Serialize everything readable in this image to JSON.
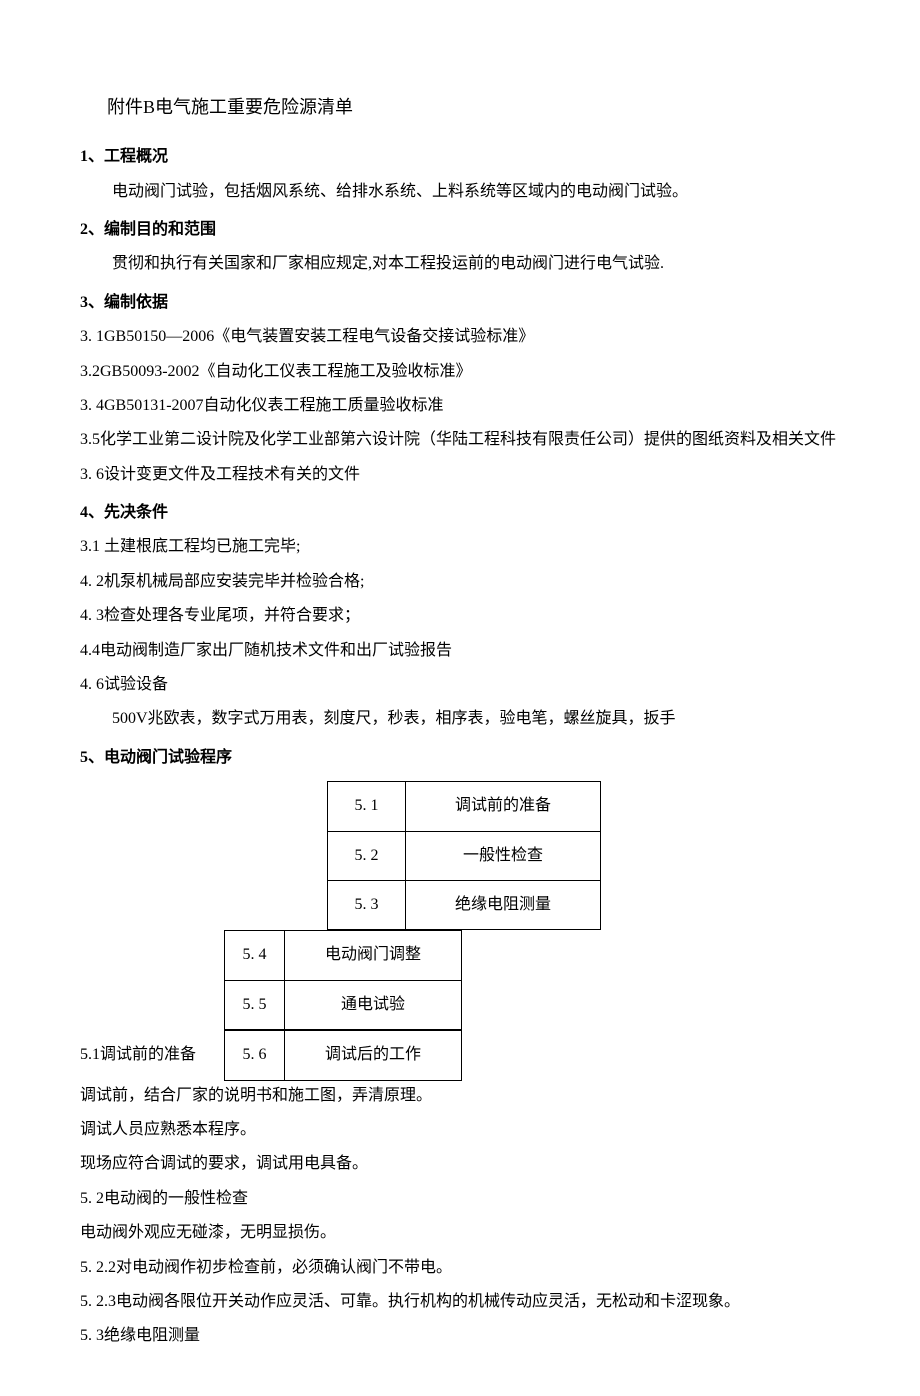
{
  "title": "附件B电气施工重要危险源清单",
  "s1": {
    "heading": "1、工程概况",
    "p1": "电动阀门试验，包括烟风系统、给排水系统、上料系统等区域内的电动阀门试验。"
  },
  "s2": {
    "heading": "2、编制目的和范围",
    "p1": "贯彻和执行有关国家和厂家相应规定,对本工程投运前的电动阀门进行电气试验."
  },
  "s3": {
    "heading": "3、编制依据",
    "i1": "3.  1GB50150—2006《电气装置安装工程电气设备交接试验标准》",
    "i2": "3.2GB50093-2002《自动化工仪表工程施工及验收标准》",
    "i3": "3.  4GB50131-2007自动化仪表工程施工质量验收标准",
    "i4": "3.5化学工业第二设计院及化学工业部第六设计院（华陆工程科技有限责任公司）提供的图纸资料及相关文件",
    "i5": "3.  6设计变更文件及工程技术有关的文件"
  },
  "s4": {
    "heading": "4、先决条件",
    "i1": "3.1  土建根底工程均已施工完毕;",
    "i2": "4.  2机泵机械局部应安装完毕并检验合格;",
    "i3": "4.  3检查处理各专业尾项，并符合要求；",
    "i4": "4.4电动阀制造厂家出厂随机技术文件和出厂试验报告",
    "i5": "4.  6试验设备",
    "i5b": "500V兆欧表，数字式万用表，刻度尺，秒表，相序表，验电笔，螺丝旋具，扳手"
  },
  "s5": {
    "heading": "5、电动阀门试验程序",
    "rows1": [
      {
        "num": "5. 1",
        "text": "调试前的准备"
      },
      {
        "num": "5. 2",
        "text": "一般性检查"
      },
      {
        "num": "5. 3",
        "text": "绝缘电阻测量"
      }
    ],
    "rows2": [
      {
        "num": "5. 4",
        "text": "电动阀门调整"
      },
      {
        "num": "5. 5",
        "text": "通电试验"
      },
      {
        "num": "5. 6",
        "text": "调试后的工作"
      }
    ],
    "p51_label": "5.1调试前的准备",
    "p51a": "调试前，结合厂家的说明书和施工图，弄清原理。",
    "p51b": "调试人员应熟悉本程序。",
    "p51c": "现场应符合调试的要求，调试用电具备。",
    "p52": "5.  2电动阀的一般性检查",
    "p52a": "电动阀外观应无碰漆，无明显损伤。",
    "p52b": "5.  2.2对电动阀作初步检查前，必须确认阀门不带电。",
    "p52c": "5.  2.3电动阀各限位开关动作应灵活、可靠。执行机构的机械传动应灵活，无松动和卡涩现象。",
    "p53": "5.  3绝缘电阻测量"
  }
}
